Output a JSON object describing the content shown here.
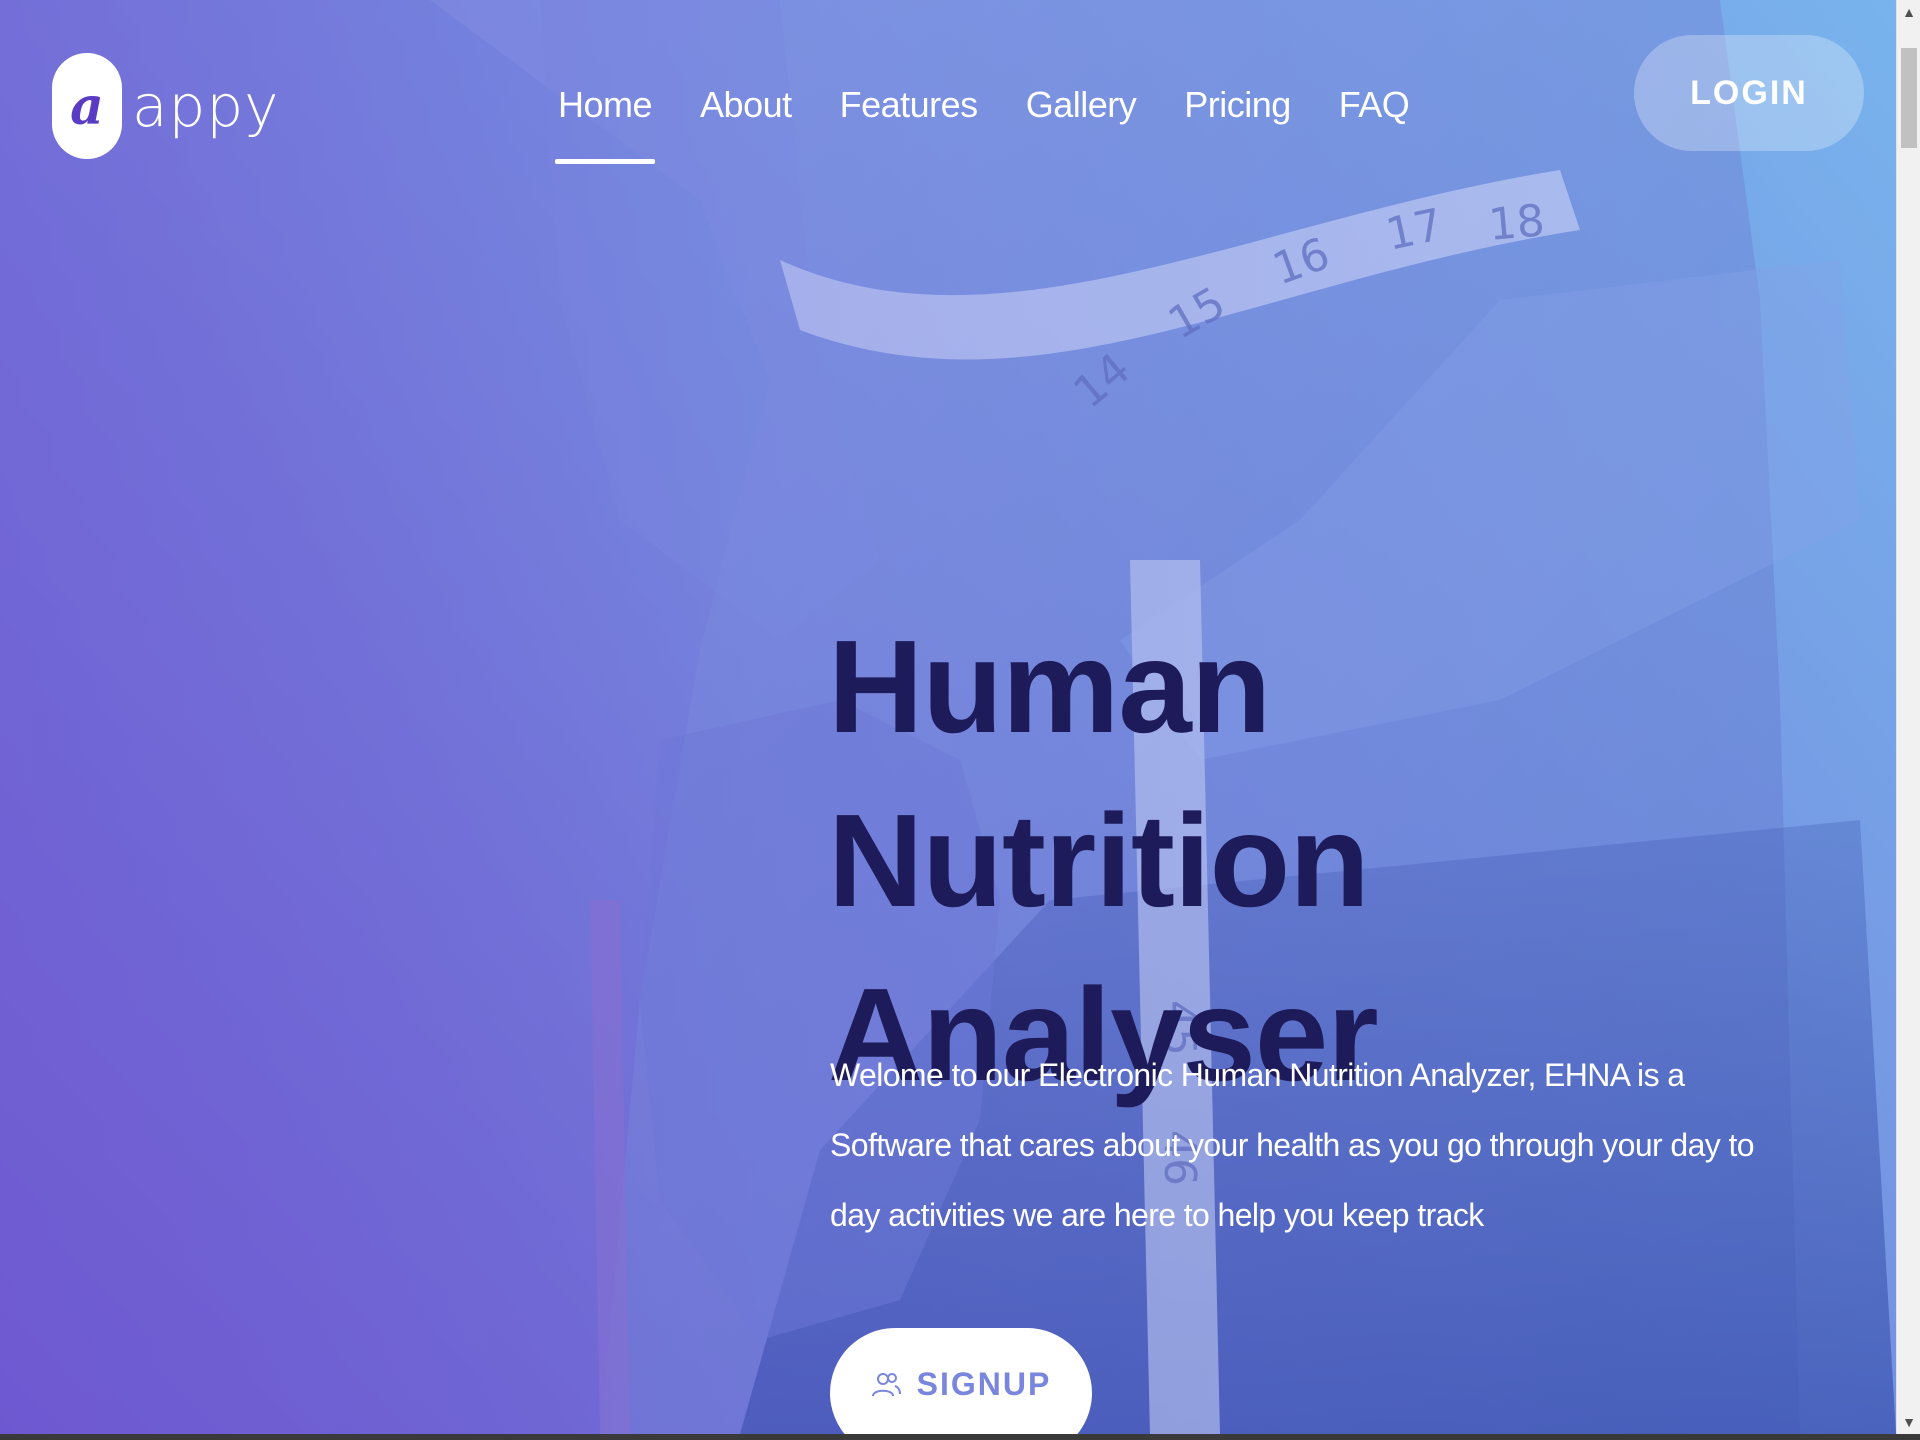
{
  "brand": {
    "logo_letter": "a",
    "logo_word": "appy"
  },
  "nav": {
    "items": [
      {
        "label": "Home",
        "active": true
      },
      {
        "label": "About",
        "active": false
      },
      {
        "label": "Features",
        "active": false
      },
      {
        "label": "Gallery",
        "active": false
      },
      {
        "label": "Pricing",
        "active": false
      },
      {
        "label": "FAQ",
        "active": false
      }
    ],
    "login_label": "LOGIN"
  },
  "hero": {
    "title_line1": "Human Nutrition",
    "title_line2": "Analyser",
    "description": "Welome to our Electronic Human Nutrition Analyzer, EHNA is a Software that cares about your health as you go through your day to day activities we are here to help you keep track",
    "signup_label": "SIGNUP",
    "signup_icon": "user-group-icon"
  },
  "colors": {
    "gradient_start": "#6a4fcb",
    "gradient_end": "#7ab7ee",
    "title": "#1e1b5a",
    "signup_text": "#7a86dd"
  },
  "icons": {
    "scroll_up": "▲",
    "scroll_down": "▼"
  }
}
